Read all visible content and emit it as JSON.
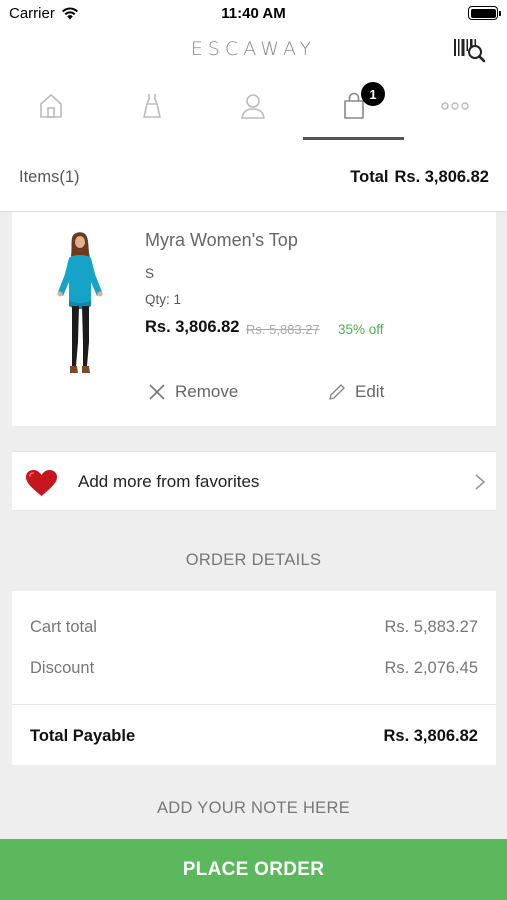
{
  "status_bar": {
    "carrier": "Carrier",
    "time": "11:40 AM"
  },
  "header": {
    "brand": "ESCAWAY",
    "scan_icon": "barcode-search-icon"
  },
  "tabs": [
    {
      "icon": "home-icon",
      "active": false
    },
    {
      "icon": "dress-icon",
      "active": false
    },
    {
      "icon": "user-icon",
      "active": false
    },
    {
      "icon": "shopping-bag-icon",
      "active": true,
      "badge": "1"
    },
    {
      "icon": "more-icon",
      "active": false
    }
  ],
  "summary": {
    "items_label": "Items(1)",
    "total_label": "Total",
    "total_value": "Rs. 3,806.82"
  },
  "product": {
    "name": "Myra Women's Top",
    "size": "S",
    "qty": "Qty: 1",
    "price": "Rs. 3,806.82",
    "mrp": "Rs. 5,883.27",
    "discount": "35% off",
    "remove_label": "Remove",
    "edit_label": "Edit"
  },
  "favorites": {
    "label": "Add more from favorites"
  },
  "order_details": {
    "title": "ORDER DETAILS",
    "rows": [
      {
        "label": "Cart total",
        "value": "Rs. 5,883.27"
      },
      {
        "label": "Discount",
        "value": "Rs. 2,076.45"
      }
    ],
    "total_label": "Total Payable",
    "total_value": "Rs. 3,806.82"
  },
  "note": {
    "label": "ADD YOUR NOTE HERE"
  },
  "place_order": {
    "label": "PLACE ORDER"
  },
  "colors": {
    "accent_green": "#5cb85c",
    "discount_green": "#4caf50",
    "heart_red": "#d81b1b"
  }
}
